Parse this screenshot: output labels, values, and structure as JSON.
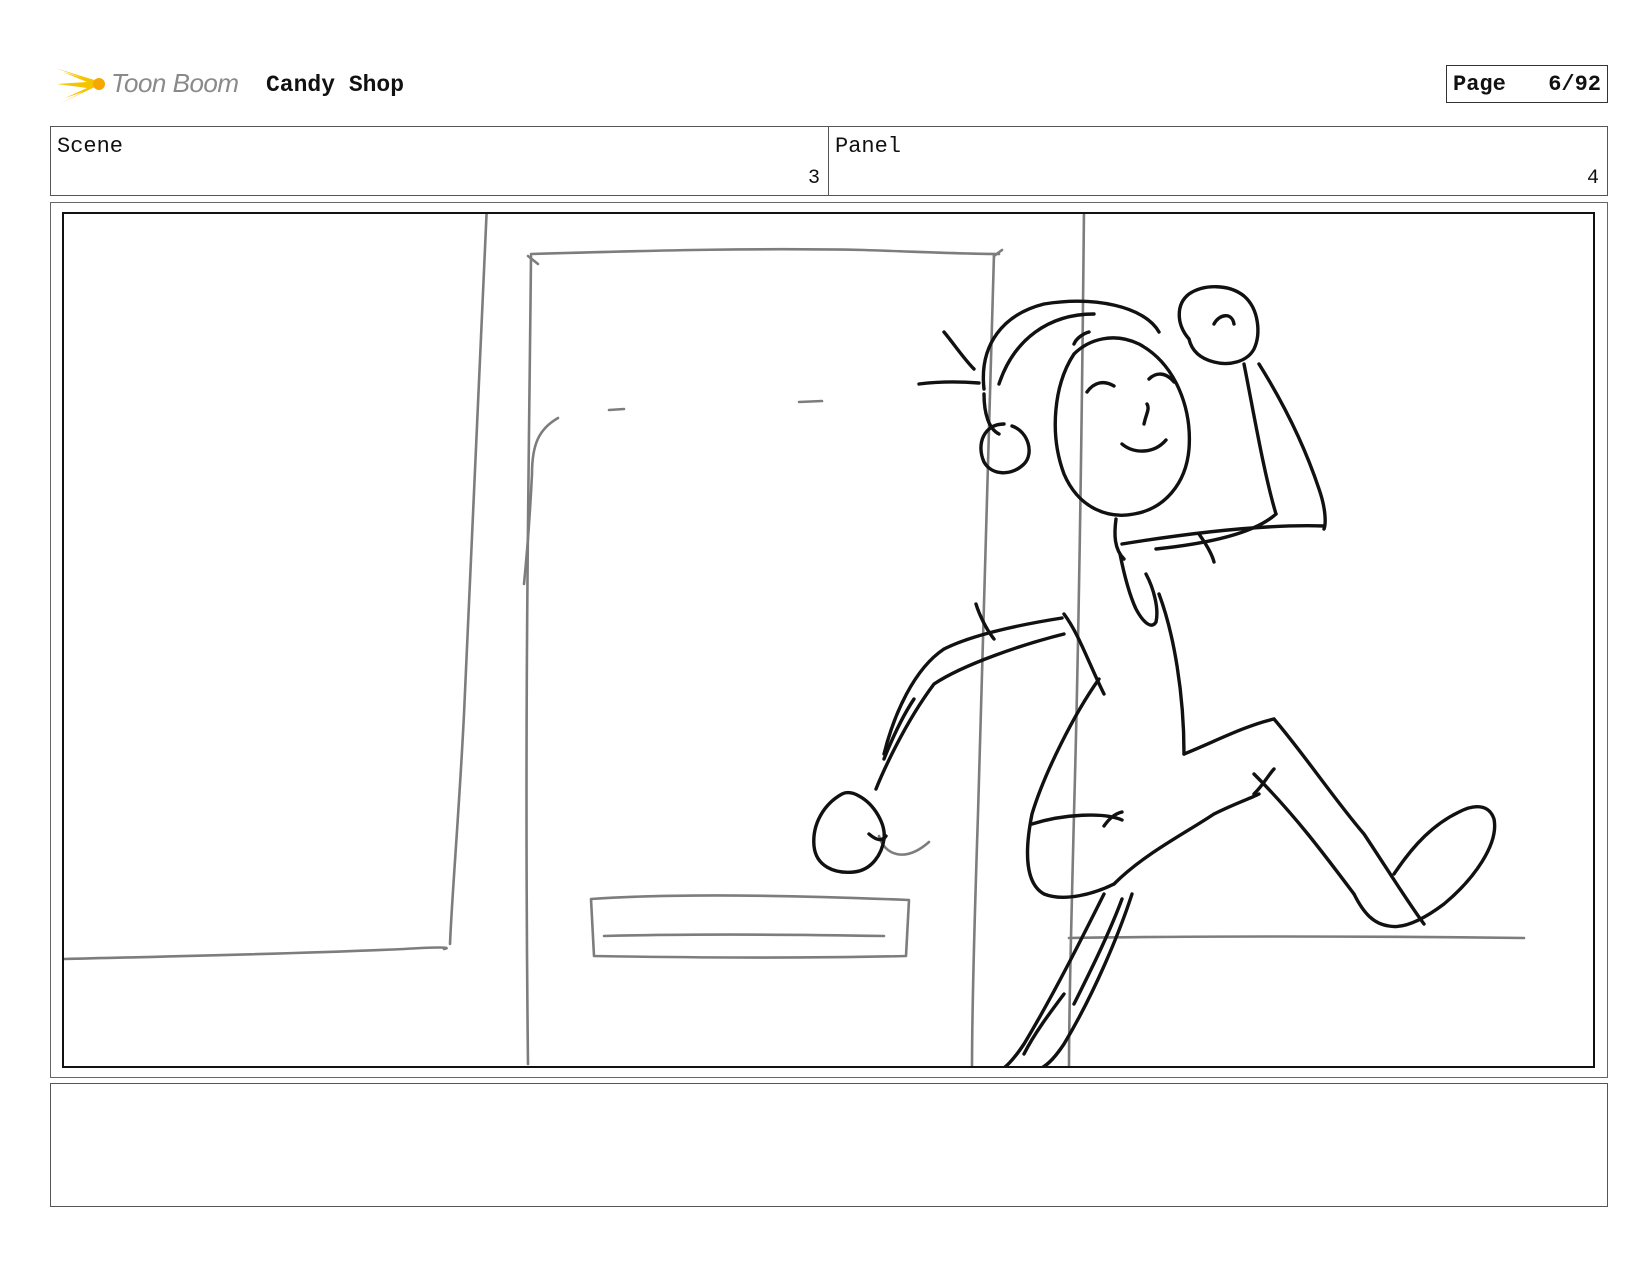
{
  "header": {
    "brand": "Toon Boom",
    "project_title": "Candy Shop",
    "page_label": "Page",
    "page_number": "6/92",
    "logo_icon": "toon-boom-burst-icon",
    "brand_color": "#f5c400"
  },
  "info": {
    "scene_label": "Scene",
    "scene_value": "3",
    "panel_label": "Panel",
    "panel_value": "4"
  },
  "frame": {
    "content": "storyboard-sketch-running-character"
  },
  "notes": {
    "text": ""
  }
}
